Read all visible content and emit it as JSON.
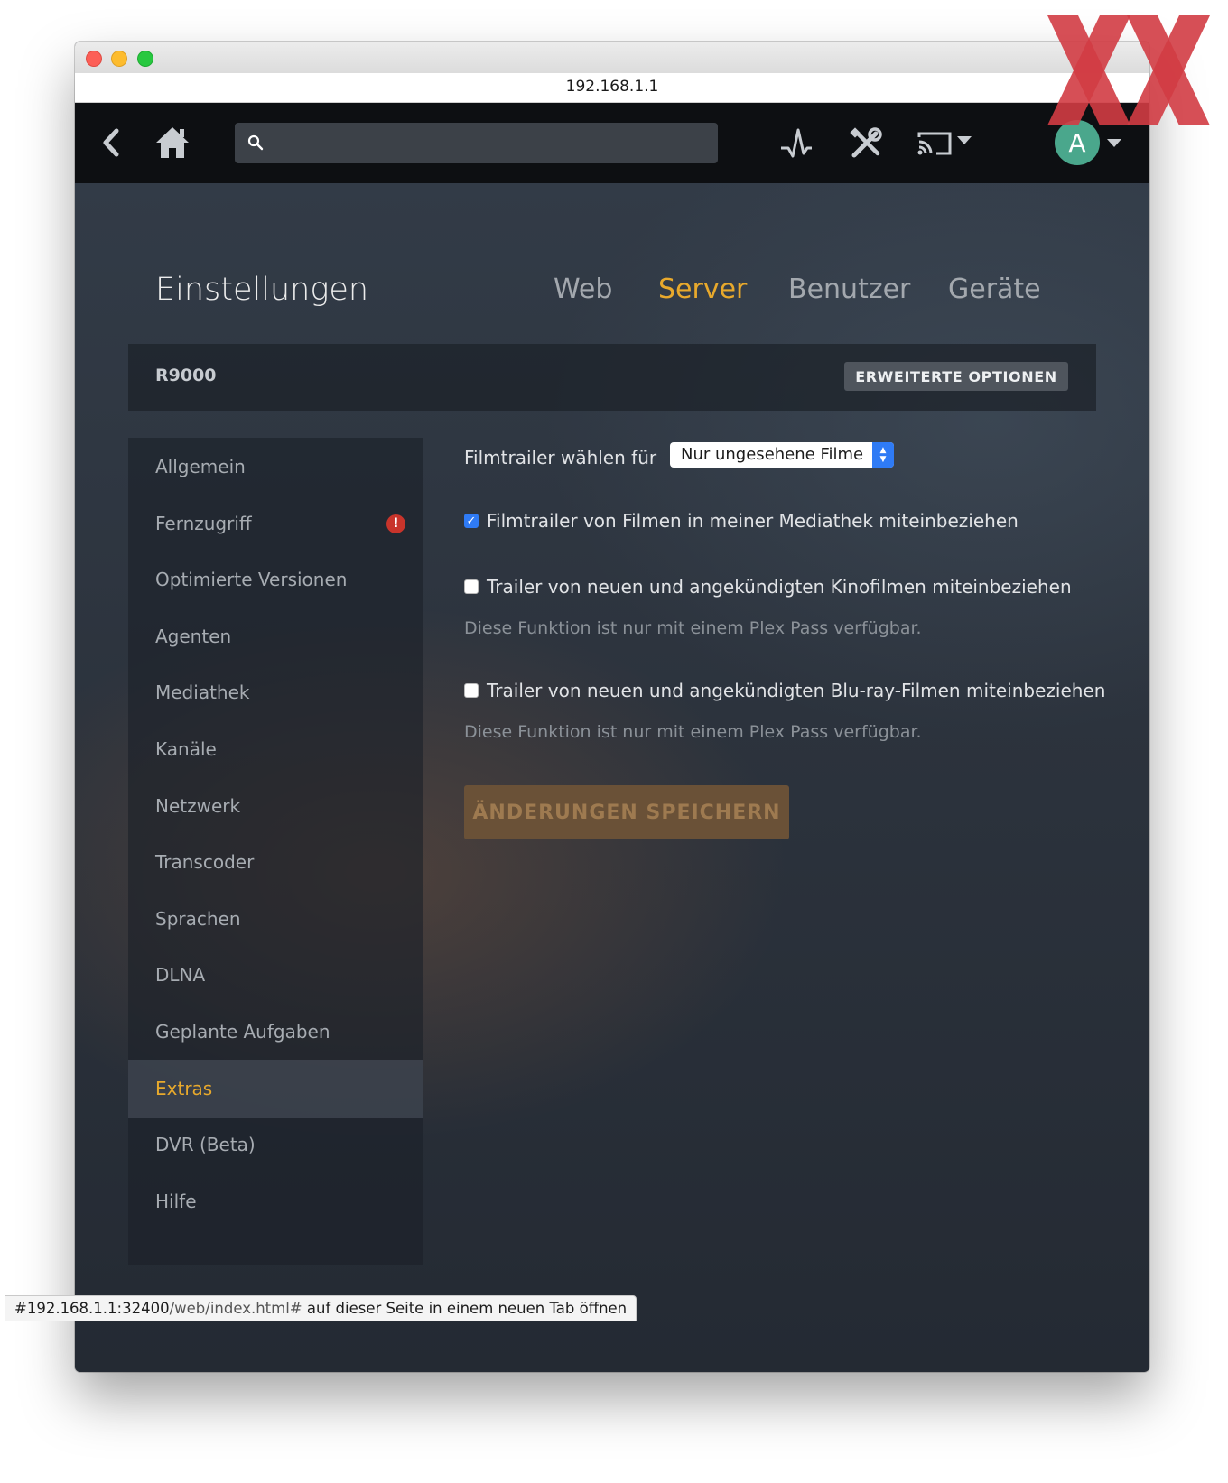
{
  "browser": {
    "url": "192.168.1.1",
    "status_link_host": "#192.168.1.1:32400",
    "status_link_path": "/web/index.html#",
    "status_suffix": " auf dieser Seite in einem neuen Tab öffnen"
  },
  "appbar": {
    "icons": [
      "back-arrow-icon",
      "home-icon",
      "search-icon",
      "activity-icon",
      "tools-icon",
      "cast-icon",
      "caret-down-icon"
    ],
    "avatar_letter": "A"
  },
  "header": {
    "title": "Einstellungen",
    "tabs": [
      {
        "label": "Web",
        "active": false
      },
      {
        "label": "Server",
        "active": true
      },
      {
        "label": "Benutzer",
        "active": false
      },
      {
        "label": "Geräte",
        "active": false
      }
    ]
  },
  "server": {
    "name": "R9000",
    "advanced_button": "ERWEITERTE OPTIONEN"
  },
  "sidebar": {
    "items": [
      {
        "label": "Allgemein"
      },
      {
        "label": "Fernzugriff",
        "alert": "!"
      },
      {
        "label": "Optimierte Versionen"
      },
      {
        "label": "Agenten"
      },
      {
        "label": "Mediathek"
      },
      {
        "label": "Kanäle"
      },
      {
        "label": "Netzwerk"
      },
      {
        "label": "Transcoder"
      },
      {
        "label": "Sprachen"
      },
      {
        "label": "DLNA"
      },
      {
        "label": "Geplante Aufgaben"
      },
      {
        "label": "Extras",
        "active": true
      },
      {
        "label": "DVR (Beta)"
      },
      {
        "label": "Hilfe"
      }
    ]
  },
  "extras": {
    "trailer_select_label": "Filmtrailer wählen für",
    "trailer_select_value": "Nur ungesehene Filme",
    "options": [
      {
        "label": "Filmtrailer von Filmen in meiner Mediathek miteinbeziehen",
        "checked": true
      },
      {
        "label": "Trailer von neuen und angekündigten Kinofilmen miteinbeziehen",
        "checked": false,
        "hint": "Diese Funktion ist nur mit einem Plex Pass verfügbar."
      },
      {
        "label": "Trailer von neuen und angekündigten Blu-ray-Filmen miteinbeziehen",
        "checked": false,
        "hint": "Diese Funktion ist nur mit einem Plex Pass verfügbar."
      }
    ],
    "save_button": "ÄNDERUNGEN SPEICHERN"
  },
  "colors": {
    "accent": "#e8a92c",
    "checkbox_blue": "#2f7bf5",
    "alert_red": "#c8342b",
    "avatar_green": "#4aa78c",
    "watermark_red": "#d23c44"
  }
}
